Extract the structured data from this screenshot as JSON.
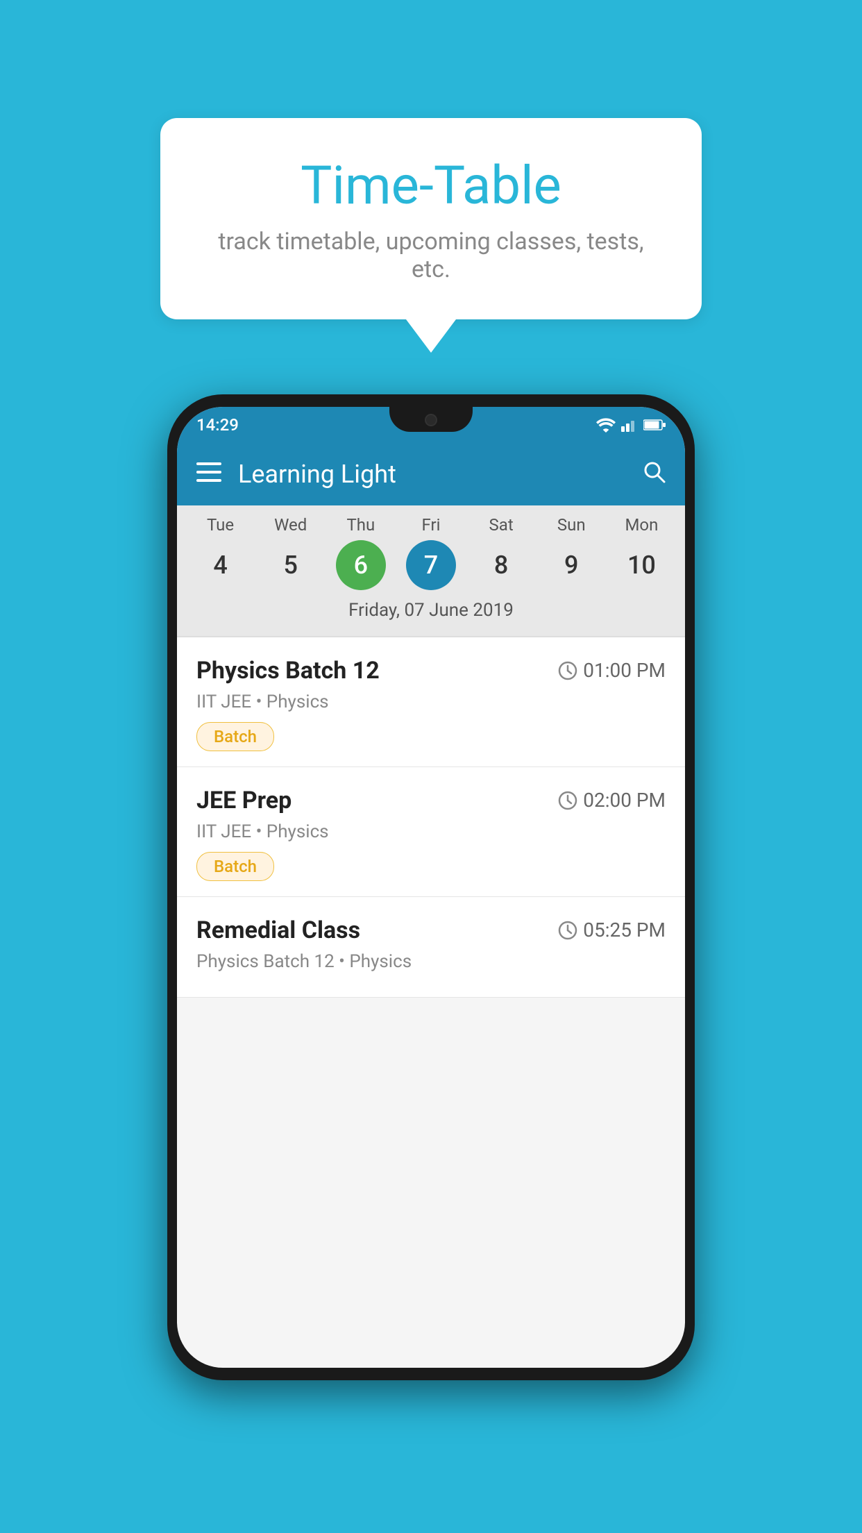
{
  "page": {
    "background_color": "#29B6D8"
  },
  "speech_bubble": {
    "title": "Time-Table",
    "subtitle": "track timetable, upcoming classes, tests, etc."
  },
  "phone": {
    "status_bar": {
      "time": "14:29"
    },
    "app_bar": {
      "title": "Learning Light"
    },
    "calendar": {
      "days": [
        {
          "label": "Tue",
          "number": "4"
        },
        {
          "label": "Wed",
          "number": "5"
        },
        {
          "label": "Thu",
          "number": "6",
          "state": "today"
        },
        {
          "label": "Fri",
          "number": "7",
          "state": "selected"
        },
        {
          "label": "Sat",
          "number": "8"
        },
        {
          "label": "Sun",
          "number": "9"
        },
        {
          "label": "Mon",
          "number": "10"
        }
      ],
      "selected_date": "Friday, 07 June 2019"
    },
    "classes": [
      {
        "name": "Physics Batch 12",
        "time": "01:00 PM",
        "meta": "IIT JEE • Physics",
        "badge": "Batch"
      },
      {
        "name": "JEE Prep",
        "time": "02:00 PM",
        "meta": "IIT JEE • Physics",
        "badge": "Batch"
      },
      {
        "name": "Remedial Class",
        "time": "05:25 PM",
        "meta": "Physics Batch 12 • Physics",
        "badge": null
      }
    ]
  }
}
